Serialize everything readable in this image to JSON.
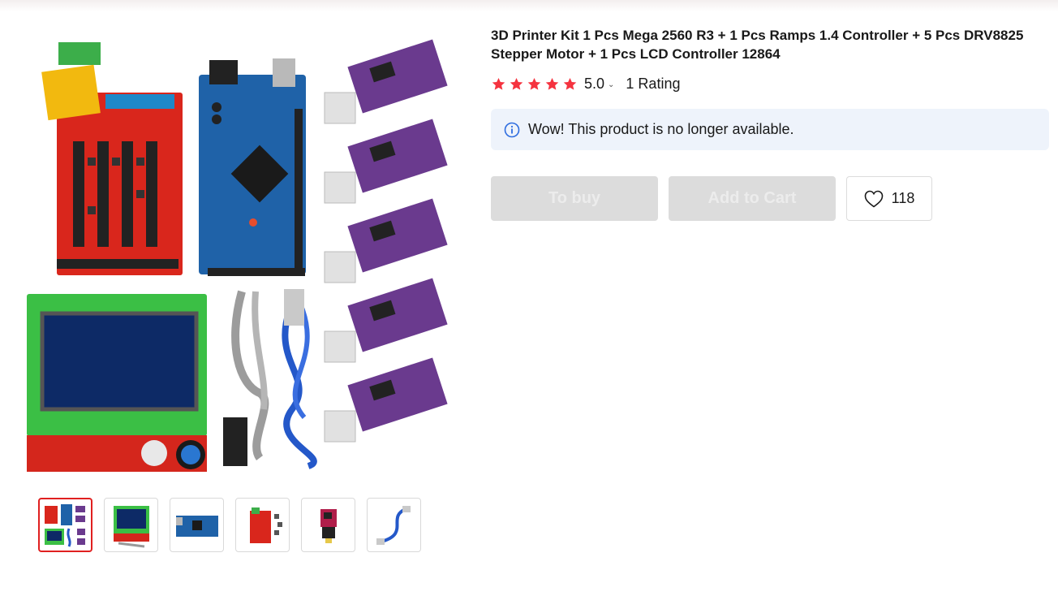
{
  "product": {
    "title": "3D Printer Kit 1 Pcs Mega 2560 R3 + 1 Pcs Ramps 1.4 Controller + 5 Pcs DRV8825 Stepper Motor + 1 Pcs LCD Controller 12864",
    "rating_value": "5.0",
    "rating_stars": 5,
    "rating_count_text": "1 Rating"
  },
  "notice": {
    "icon": "info-icon",
    "text": "Wow! This product is no longer available."
  },
  "actions": {
    "buy_label": "To buy",
    "cart_label": "Add to Cart",
    "wishlist_count": "118",
    "wishlist_icon": "heart-icon"
  },
  "gallery": {
    "selected_index": 0,
    "thumbnails": [
      "kit-overview",
      "lcd-controller",
      "mega-2560-board",
      "ramps-board",
      "drv8825-driver",
      "usb-cable"
    ]
  },
  "colors": {
    "star": "#f5333f",
    "active_thumb_border": "#e02020",
    "notice_bg": "#eef3fb",
    "info_icon": "#2d6cdf",
    "disabled_button_bg": "#dcdcdc"
  }
}
